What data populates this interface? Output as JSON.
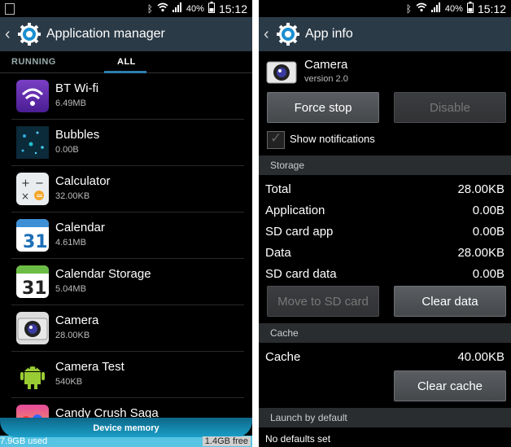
{
  "status": {
    "battery": "40%",
    "time": "15:12"
  },
  "left": {
    "title": "Application manager",
    "tabs": [
      "RUNNING",
      "ALL"
    ],
    "apps": [
      {
        "name": "BT Wi-fi",
        "size": "6.49MB",
        "icon": "wifi-app-icon"
      },
      {
        "name": "Bubbles",
        "size": "0.00B",
        "icon": "bubbles-app-icon"
      },
      {
        "name": "Calculator",
        "size": "32.00KB",
        "icon": "calculator-app-icon"
      },
      {
        "name": "Calendar",
        "size": "4.61MB",
        "icon": "calendar-app-icon"
      },
      {
        "name": "Calendar Storage",
        "size": "5.04MB",
        "icon": "calendar-storage-app-icon"
      },
      {
        "name": "Camera",
        "size": "28.00KB",
        "icon": "camera-app-icon"
      },
      {
        "name": "Camera Test",
        "size": "540KB",
        "icon": "android-app-icon"
      },
      {
        "name": "Candy Crush Saga",
        "size": "",
        "icon": "candy-crush-app-icon"
      }
    ],
    "memory": {
      "label": "Device memory",
      "used": "7.9GB used",
      "free": "1.4GB free"
    }
  },
  "right": {
    "title": "App info",
    "app": {
      "name": "Camera",
      "version": "version 2.0"
    },
    "buttons": {
      "force_stop": "Force stop",
      "disable": "Disable",
      "move_sd": "Move to SD card",
      "clear_data": "Clear data",
      "clear_cache": "Clear cache"
    },
    "show_notifications": "Show notifications",
    "storage_header": "Storage",
    "storage": [
      {
        "k": "Total",
        "v": "28.00KB"
      },
      {
        "k": "Application",
        "v": "0.00B"
      },
      {
        "k": "SD card app",
        "v": "0.00B"
      },
      {
        "k": "Data",
        "v": "28.00KB"
      },
      {
        "k": "SD card data",
        "v": "0.00B"
      }
    ],
    "cache_header": "Cache",
    "cache": {
      "k": "Cache",
      "v": "40.00KB"
    },
    "launch_header": "Launch by default",
    "launch_text": "No defaults set"
  }
}
